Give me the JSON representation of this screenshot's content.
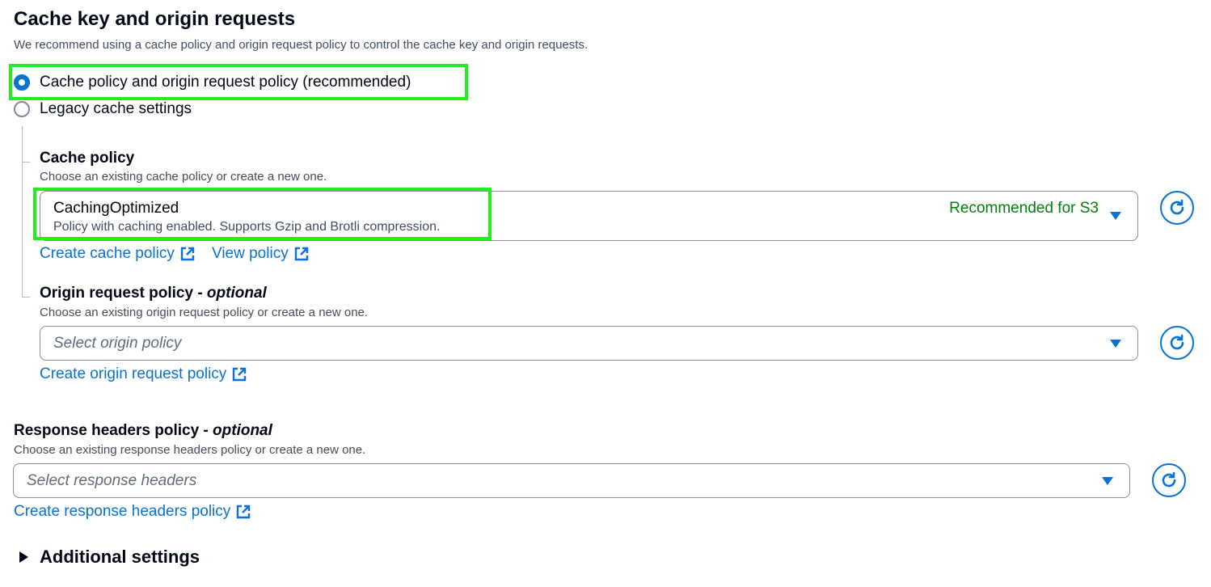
{
  "section": {
    "title": "Cache key and origin requests",
    "description": "We recommend using a cache policy and origin request policy to control the cache key and origin requests."
  },
  "radio_options": [
    {
      "label": "Cache policy and origin request policy (recommended)",
      "selected": true
    },
    {
      "label": "Legacy cache settings",
      "selected": false
    }
  ],
  "cache_policy": {
    "label": "Cache policy",
    "description": "Choose an existing cache policy or create a new one.",
    "selected_title": "CachingOptimized",
    "selected_description": "Policy with caching enabled. Supports Gzip and Brotli compression.",
    "badge": "Recommended for S3",
    "create_link": "Create cache policy",
    "view_link": "View policy"
  },
  "origin_request_policy": {
    "label": "Origin request policy - ",
    "label_optional": "optional",
    "description": "Choose an existing origin request policy or create a new one.",
    "placeholder": "Select origin policy",
    "create_link": "Create origin request policy"
  },
  "response_headers_policy": {
    "label": "Response headers policy - ",
    "label_optional": "optional",
    "description": "Choose an existing response headers policy or create a new one.",
    "placeholder": "Select response headers",
    "create_link": "Create response headers policy"
  },
  "additional_settings": {
    "label": "Additional settings",
    "expanded": false
  },
  "colors": {
    "accent": "#0972d3",
    "success": "#037f0c",
    "highlight": "#22ee22",
    "text": "#000716",
    "secondary_text": "#414d5c"
  },
  "icons": {
    "refresh": "refresh-icon",
    "external_link": "external-link-icon",
    "caret": "caret-down-icon",
    "expand": "caret-right-icon"
  }
}
